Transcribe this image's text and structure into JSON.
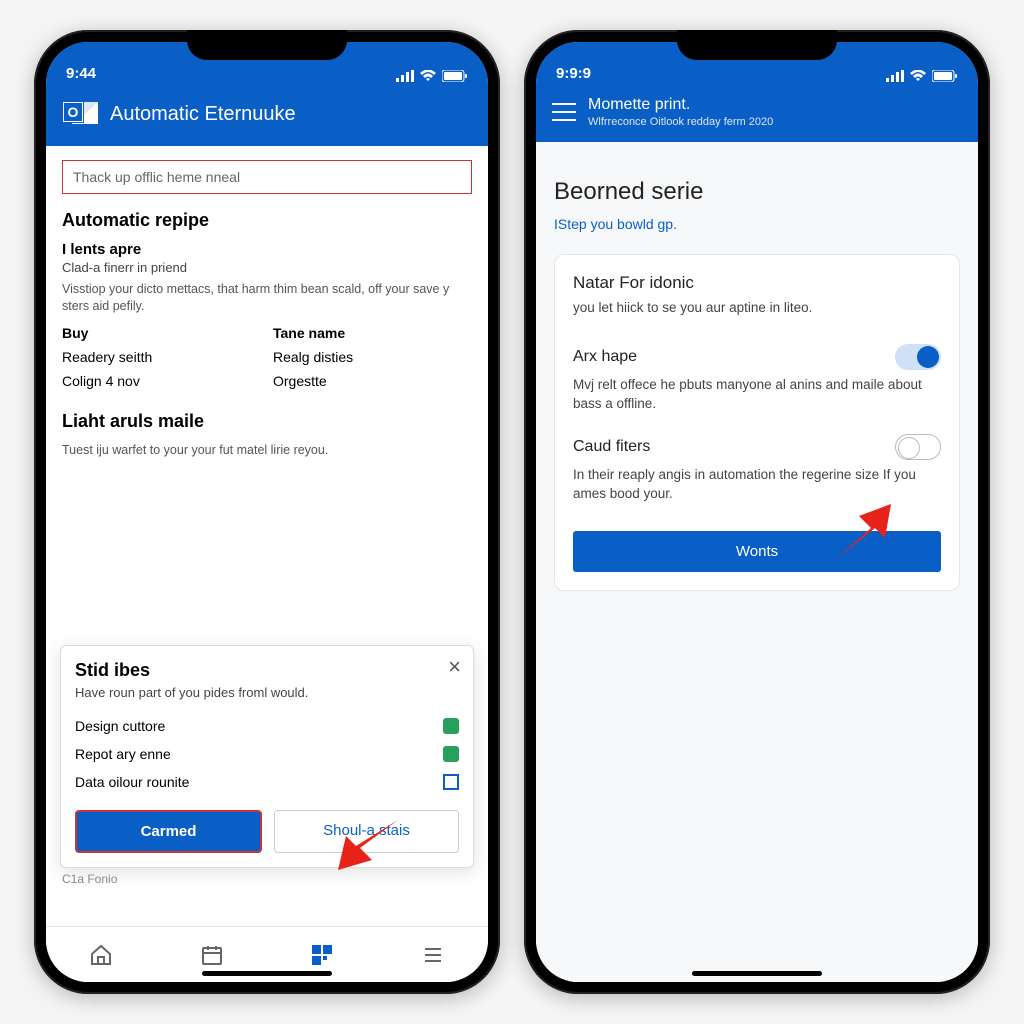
{
  "left": {
    "time": "9:44",
    "app_title": "Automatic Eternuuke",
    "search_placeholder": "Thack up offlic heme nneal",
    "section_title": "Automatic repipe",
    "sub_heading": "I lents apre",
    "sub_desc": "Clad-a finerr in priend",
    "paragraph": "Visstiop your dicto mettacs, that harm thim bean scald, off your save y sters aid pefily.",
    "table": {
      "rows": [
        {
          "left": "Buy",
          "right": "Tane name",
          "bold": true
        },
        {
          "left": "Readery seitth",
          "right": "Realg disties",
          "bold": false
        },
        {
          "left": "Colign 4 nov",
          "right": "Orgestte",
          "bold": false
        }
      ]
    },
    "section2_title": "Liaht aruls maile",
    "section2_para": "Tuest iju warfet to your your fut matel lirie reyou.",
    "popup": {
      "title": "Stid ibes",
      "subtitle": "Have roun part of you pides froml would.",
      "items": [
        {
          "label": "Design cuttore",
          "checked": true
        },
        {
          "label": "Repot ary enne",
          "checked": true
        },
        {
          "label": "Data oilour rounite",
          "checked": false
        }
      ],
      "primary_btn": "Carmed",
      "secondary_btn": "Shoul-a stais"
    },
    "footer": "C1a Fonio"
  },
  "right": {
    "time": "9:9:9",
    "header_title": "Momette print.",
    "header_sub": "Wlfrreconce Oitlook redday ferm 2020",
    "page_title": "Beorned serie",
    "step_link": "IStep you bowld gp.",
    "card": {
      "title": "Natar For idonic",
      "p1": "you let hiick to se you aur aptine in liteo.",
      "toggle1_label": "Arx hape",
      "toggle1_desc": "Mvj relt offece he pbuts manyone al anins and maile about bass a offline.",
      "toggle1_on": true,
      "toggle2_label": "Caud fiters",
      "toggle2_desc": "In their reaply angis in automation the regerine size If you ames bood your.",
      "toggle2_on": false,
      "button": "Wonts"
    }
  }
}
